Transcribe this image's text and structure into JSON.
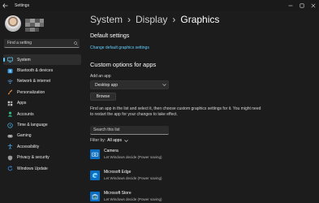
{
  "window": {
    "title": "Settings",
    "controls": {
      "minimize": "minimize-icon",
      "maximize": "maximize-icon",
      "close": "close-icon"
    }
  },
  "sidebar": {
    "search_placeholder": "Find a setting",
    "items": [
      {
        "label": "System",
        "icon": "monitor-icon",
        "active": true,
        "color": "#60cdff"
      },
      {
        "label": "Bluetooth & devices",
        "icon": "bluetooth-icon",
        "color": "#3a96dd"
      },
      {
        "label": "Network & internet",
        "icon": "network-icon",
        "color": "#60a5e0"
      },
      {
        "label": "Personalization",
        "icon": "brush-icon",
        "color": "#e8924a"
      },
      {
        "label": "Apps",
        "icon": "apps-icon",
        "color": "#c9c9c9"
      },
      {
        "label": "Accounts",
        "icon": "person-icon",
        "color": "#2fb67c"
      },
      {
        "label": "Time & language",
        "icon": "globe-clock-icon",
        "color": "#4cb3e6"
      },
      {
        "label": "Gaming",
        "icon": "gamepad-icon",
        "color": "#b8b8b8"
      },
      {
        "label": "Accessibility",
        "icon": "accessibility-icon",
        "color": "#4aa3e0"
      },
      {
        "label": "Privacy & security",
        "icon": "shield-icon",
        "color": "#9a9a9a"
      },
      {
        "label": "Windows Update",
        "icon": "update-icon",
        "color": "#2f89d8"
      }
    ]
  },
  "breadcrumb": [
    "System",
    "Display",
    "Graphics"
  ],
  "default_settings": {
    "heading": "Default settings",
    "link": "Change default graphics settings"
  },
  "custom_options": {
    "heading": "Custom options for apps",
    "add_app_label": "Add an app",
    "dropdown_value": "Desktop app",
    "browse_label": "Browse",
    "description": "Find an app in the list and select it, then choose custom graphics settings for it. You might need to restart the app for your changes to take effect.",
    "list_search_placeholder": "Search this list",
    "filter_label": "Filter by:",
    "filter_value": "All apps"
  },
  "apps": [
    {
      "name": "Camera",
      "status": "Let Windows decide (Power saving)",
      "icon": "camera-icon"
    },
    {
      "name": "Microsoft Edge",
      "status": "Let Windows decide (Power saving)",
      "icon": "edge-icon"
    },
    {
      "name": "Microsoft Store",
      "status": "Let Windows decide (Power saving)",
      "icon": "store-icon"
    }
  ],
  "colors": {
    "accent": "#60cdff",
    "background": "#1c1c1c",
    "app_tile": "#0a6fc2"
  }
}
